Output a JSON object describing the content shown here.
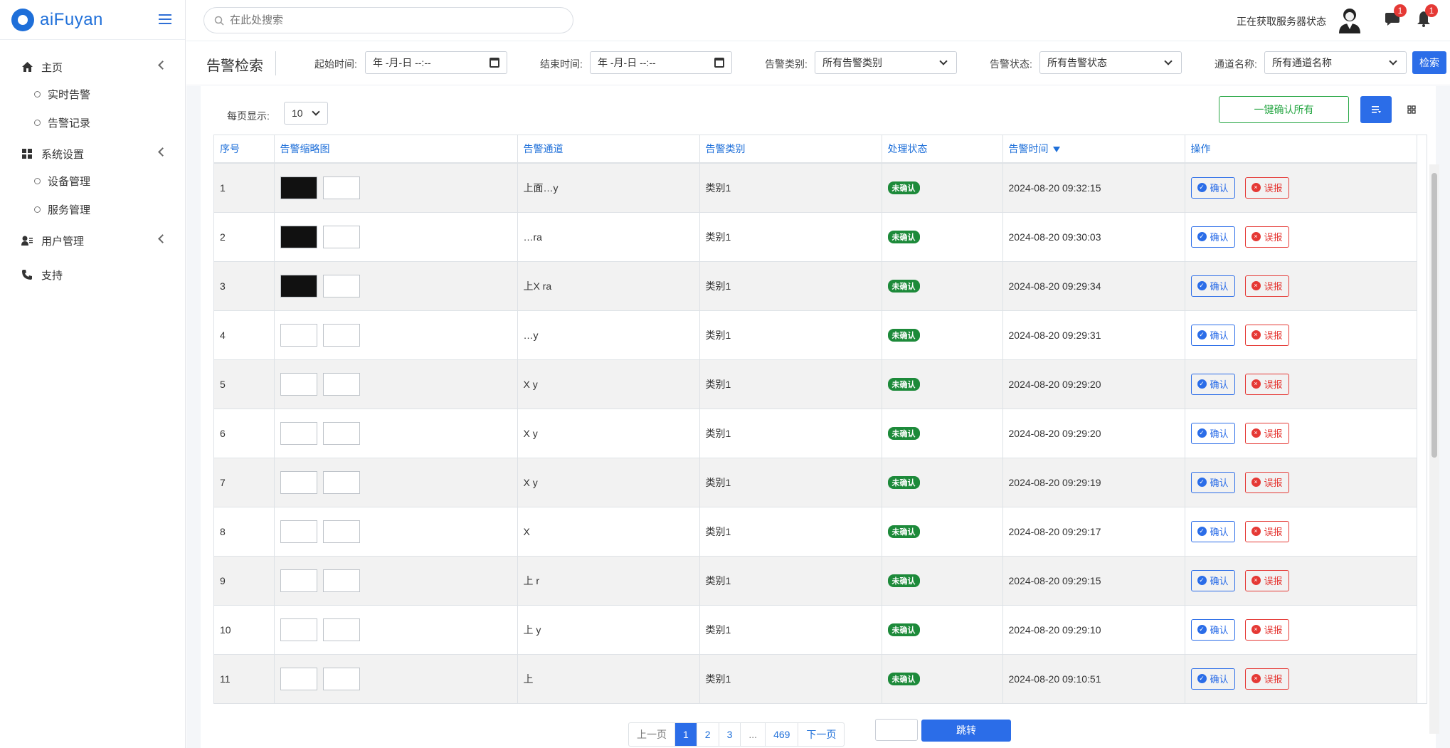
{
  "app": {
    "brand": "aiFuyan"
  },
  "sidebar": {
    "items": [
      {
        "label": "主页",
        "icon": "home-icon"
      },
      {
        "label": "实时告警",
        "sub": true
      },
      {
        "label": "告警记录",
        "sub": true
      },
      {
        "label": "系统设置",
        "icon": "grid-icon"
      },
      {
        "label": "设备管理",
        "sub": true
      },
      {
        "label": "服务管理",
        "sub": true
      },
      {
        "label": "用户管理",
        "icon": "user-icon"
      },
      {
        "label": "支持",
        "icon": "phone-icon"
      }
    ]
  },
  "topbar": {
    "search_placeholder": "在此处搜索",
    "server_status": "正在获取服务器状态",
    "messages_badge": "1",
    "notifications_badge": "1"
  },
  "filters": {
    "title": "告警检索",
    "start_label": "起始时间:",
    "start_value": "年 -月-日 --:--",
    "end_label": "结束时间:",
    "end_value": "年 -月-日 --:--",
    "category_label": "告警类别:",
    "category_value": "所有告警类别",
    "status_label": "告警状态:",
    "status_value": "所有告警状态",
    "channel_label": "通道名称:",
    "channel_value": "所有通道名称",
    "search_button": "检索"
  },
  "list": {
    "perpage_label": "每页显示:",
    "perpage_value": "10",
    "confirm_all": "一键确认所有",
    "columns": [
      "序号",
      "告警缩略图",
      "告警通道",
      "告警类别",
      "处理状态",
      "告警时间",
      "操作"
    ],
    "confirm_label": "确认",
    "false_label": "误报",
    "rows": [
      {
        "no": "1",
        "channel": "上面…y",
        "category": "类别1",
        "status": "未确认",
        "time": "2024-08-20 09:32:15",
        "dark": true
      },
      {
        "no": "2",
        "channel": "…ra",
        "category": "类别1",
        "status": "未确认",
        "time": "2024-08-20 09:30:03",
        "dark": true
      },
      {
        "no": "3",
        "channel": "上X ra",
        "category": "类别1",
        "status": "未确认",
        "time": "2024-08-20 09:29:34",
        "dark": true
      },
      {
        "no": "4",
        "channel": "…y",
        "category": "类别1",
        "status": "未确认",
        "time": "2024-08-20 09:29:31",
        "dark": false
      },
      {
        "no": "5",
        "channel": "X y",
        "category": "类别1",
        "status": "未确认",
        "time": "2024-08-20 09:29:20",
        "dark": false
      },
      {
        "no": "6",
        "channel": "X y",
        "category": "类别1",
        "status": "未确认",
        "time": "2024-08-20 09:29:20",
        "dark": false
      },
      {
        "no": "7",
        "channel": "X y",
        "category": "类别1",
        "status": "未确认",
        "time": "2024-08-20 09:29:19",
        "dark": false
      },
      {
        "no": "8",
        "channel": "X",
        "category": "类别1",
        "status": "未确认",
        "time": "2024-08-20 09:29:17",
        "dark": false
      },
      {
        "no": "9",
        "channel": "上 r",
        "category": "类别1",
        "status": "未确认",
        "time": "2024-08-20 09:29:15",
        "dark": false
      },
      {
        "no": "10",
        "channel": "上 y",
        "category": "类别1",
        "status": "未确认",
        "time": "2024-08-20 09:29:10",
        "dark": false
      },
      {
        "no": "11",
        "channel": "上",
        "category": "类别1",
        "status": "未确认",
        "time": "2024-08-20 09:10:51",
        "dark": false
      }
    ]
  },
  "pagination": {
    "prev": "上一页",
    "pages": [
      "1",
      "2",
      "3",
      "...",
      "469"
    ],
    "current": "1",
    "next": "下一页",
    "jump": "跳转"
  },
  "colors": {
    "primary": "#2b6de8",
    "success": "#28a745",
    "danger": "#e53935",
    "status_green": "#1d8a3a"
  }
}
